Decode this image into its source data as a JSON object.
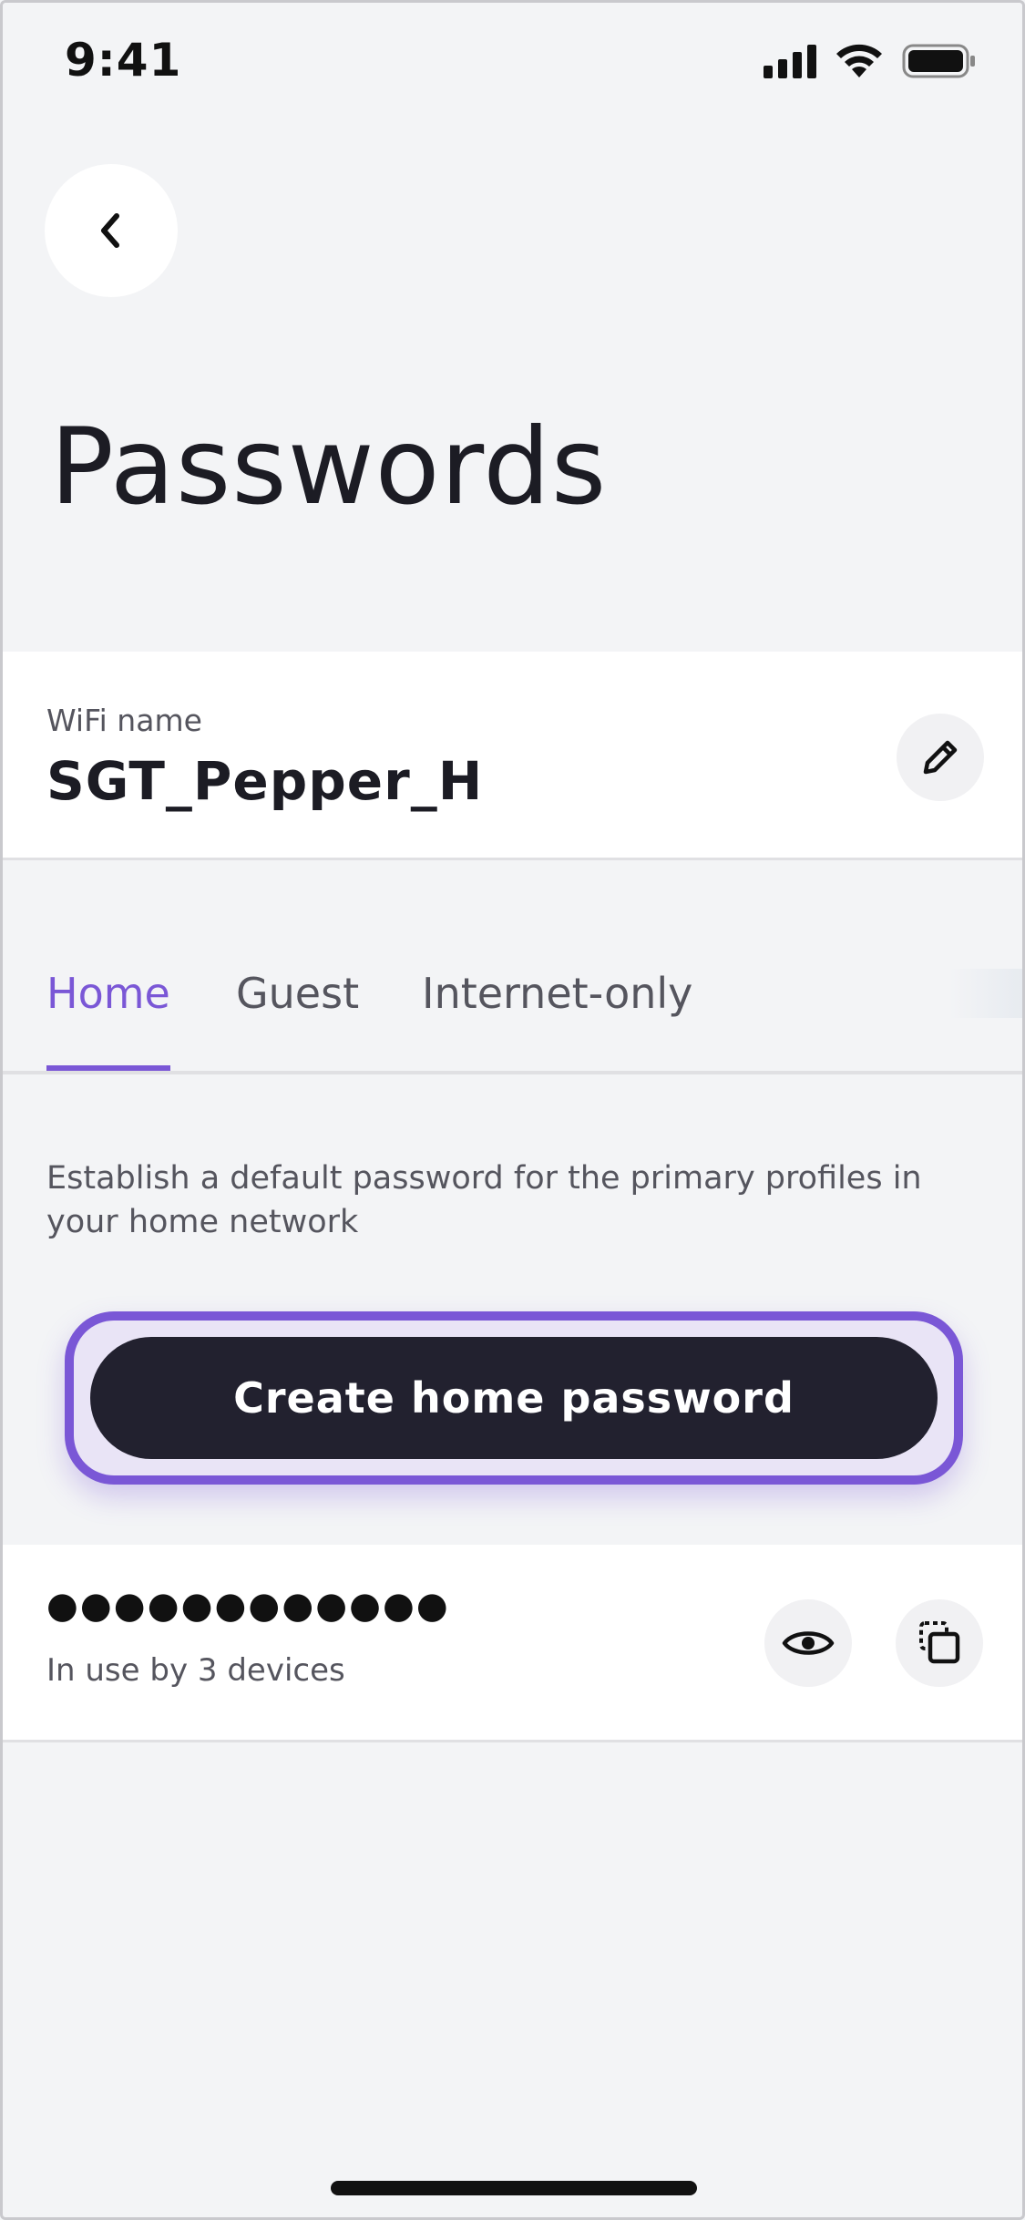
{
  "status_bar": {
    "time": "9:41",
    "icons": [
      "cellular-signal-icon",
      "wifi-icon",
      "battery-icon"
    ]
  },
  "header": {
    "back_icon": "chevron-left-icon",
    "title": "Passwords"
  },
  "wifi": {
    "label": "WiFi name",
    "name": "SGT_Pepper_H",
    "edit_icon": "pencil-icon"
  },
  "tabs": [
    {
      "label": "Home",
      "active": true
    },
    {
      "label": "Guest",
      "active": false
    },
    {
      "label": "Internet-only",
      "active": false
    }
  ],
  "home": {
    "description": "Establish a default password for the primary profiles in your home network",
    "create_button_label": "Create home password"
  },
  "password": {
    "masked_value": "●●●●●●●●●●●●",
    "usage": "In use by 3 devices",
    "show_icon": "eye-icon",
    "copy_icon": "copy-icon"
  },
  "colors": {
    "accent": "#7a57d6",
    "primary_button": "#22212f",
    "background": "#f3f4f6",
    "card": "#ffffff"
  }
}
